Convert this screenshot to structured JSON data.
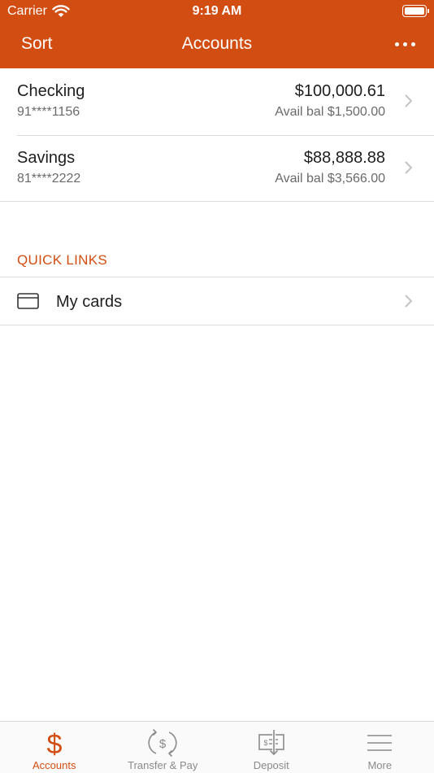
{
  "status_bar": {
    "carrier": "Carrier",
    "time": "9:19 AM"
  },
  "nav": {
    "sort_label": "Sort",
    "title": "Accounts",
    "more_icon": "ellipsis-icon"
  },
  "accounts": [
    {
      "name": "Checking",
      "number": "91****1156",
      "balance": "$100,000.61",
      "available": "Avail bal $1,500.00"
    },
    {
      "name": "Savings",
      "number": "81****2222",
      "balance": "$88,888.88",
      "available": "Avail bal $3,566.00"
    }
  ],
  "quick_links": {
    "header": "QUICK LINKS",
    "items": [
      {
        "label": "My cards",
        "icon": "credit-card-icon"
      }
    ]
  },
  "tabs": [
    {
      "label": "Accounts",
      "icon": "dollar-icon",
      "active": true
    },
    {
      "label": "Transfer & Pay",
      "icon": "transfer-icon",
      "active": false
    },
    {
      "label": "Deposit",
      "icon": "check-deposit-icon",
      "active": false
    },
    {
      "label": "More",
      "icon": "hamburger-icon",
      "active": false
    }
  ],
  "colors": {
    "brand": "#d24d11",
    "inactive_tab": "#8a8a8a",
    "divider": "#dcdcdc"
  }
}
